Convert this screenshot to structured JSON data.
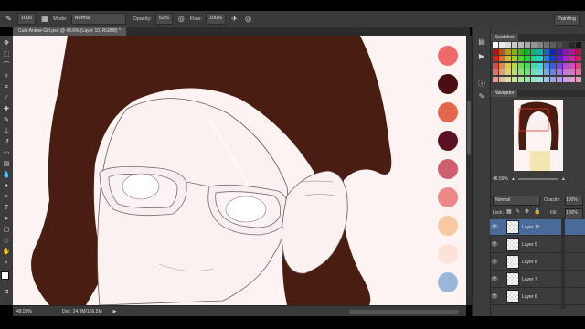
{
  "app": {
    "document_tab": "Cute Anime Girl.psd @ 48.6% (Layer 10, RGB/8) *",
    "workspace": "Painting"
  },
  "options_bar": {
    "brush_size": "1000",
    "mode_label": "Mode:",
    "mode_value": "Normal",
    "opacity_label": "Opacity:",
    "opacity_value": "52%",
    "flow_label": "Flow:",
    "flow_value": "100%"
  },
  "status": {
    "zoom": "48.59%",
    "doc_info": "Doc: 24.9M/166.5M"
  },
  "panels": {
    "swatches_tab": "Swatches",
    "navigator_tab": "Navigator",
    "navigator_zoom": "48.59%"
  },
  "layers_panel": {
    "blend_mode": "Normal",
    "opacity_label": "Opacity:",
    "opacity_value": "100%",
    "lock_label": "Lock:",
    "fill_label": "Fill:",
    "fill_value": "100%",
    "layers": [
      {
        "name": "Layer 10",
        "selected": true
      },
      {
        "name": "Layer 9",
        "selected": false
      },
      {
        "name": "Layer 8",
        "selected": false
      },
      {
        "name": "Layer 7",
        "selected": false
      },
      {
        "name": "Layer 6",
        "selected": false
      }
    ]
  },
  "canvas_palette": [
    "#ef6a6a",
    "#4a0e12",
    "#e2674c",
    "#5b1220",
    "#cd5f6f",
    "#ee8787",
    "#f6c9a2",
    "#fbe3d8",
    "#9ab7db"
  ],
  "colors": {
    "hair": "#4a1d13",
    "skin": "#fcf1f1",
    "ui_dark": "#3a3a3a",
    "selected_layer": "#4a6a9a"
  }
}
